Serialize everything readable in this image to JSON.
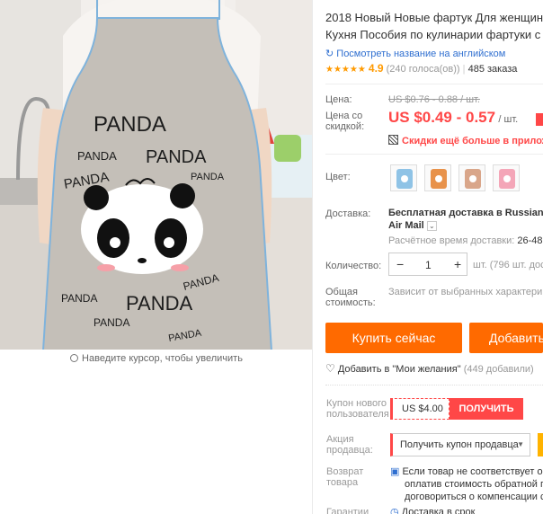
{
  "product": {
    "title_line1": "2018 Новый Новые фартук Для женщин",
    "title_line2": "Кухня Пособия по кулинарии фартуки с",
    "translate_link": "Посмотреть название на английском",
    "rating_stars": "★★★★★",
    "rating_value": "4.9",
    "votes": "(240 голоса(ов))",
    "orders": "485 заказа"
  },
  "image": {
    "apron_text": [
      "PANDA",
      "PANDA",
      "PANDA",
      "PANDA",
      "PANDA",
      "PANDA",
      "PANDA",
      "PANDA",
      "PANDA",
      "PANDA"
    ],
    "zoom_hint": "Наведите курсор, чтобы увеличить"
  },
  "price": {
    "label": "Цена:",
    "old": "US $0.76 - 0.88 / шт.",
    "discount_label_1": "Цена со",
    "discount_label_2": "скидкой:",
    "value": "US $0.49 - 0.57",
    "unit": "/ шт.",
    "promo_text": "Скидки ещё больше в приложе"
  },
  "color": {
    "label": "Цвет:",
    "swatches": [
      "#8fc3e6",
      "#e8924a",
      "#d9a68a",
      "#f4a6b8"
    ]
  },
  "shipping": {
    "label": "Доставка:",
    "line1": "Бесплатная доставка в Russian Fe",
    "line2": "Air Mail",
    "estimate_label": "Расчётное время доставки:",
    "estimate_value": "26-48"
  },
  "quantity": {
    "label": "Количество:",
    "minus": "−",
    "value": "1",
    "plus": "+",
    "stock": "шт. (796 шт. доступ"
  },
  "total": {
    "label_1": "Общая",
    "label_2": "стоимость:",
    "value": "Зависит от выбранных характери"
  },
  "actions": {
    "buy_now": "Купить сейчас",
    "add_to_cart": "Добавить",
    "wishlist": "Добавить в \"Мои желания\"",
    "wishlist_count": "(449 добавили)"
  },
  "coupon": {
    "label_1": "Купон нового",
    "label_2": "пользователя",
    "value": "US $4.00",
    "get": "ПОЛУЧИТЬ"
  },
  "seller_promo": {
    "label_1": "Акция",
    "label_2": "продавца:",
    "select": "Получить купон продавца"
  },
  "returns": {
    "label_1": "Возврат",
    "label_2": "товара",
    "line1": "Если товар не соответствует оп",
    "line2": "оплатив стоимость обратной пе",
    "line3": "договориться о компенсации с"
  },
  "guarantee": {
    "label": "Гарантии",
    "text": "Доставка в срок"
  },
  "colors": {
    "accent": "#ff4747",
    "orange": "#ff6a00",
    "star": "#ff9a00",
    "link": "#2f6fd0"
  }
}
